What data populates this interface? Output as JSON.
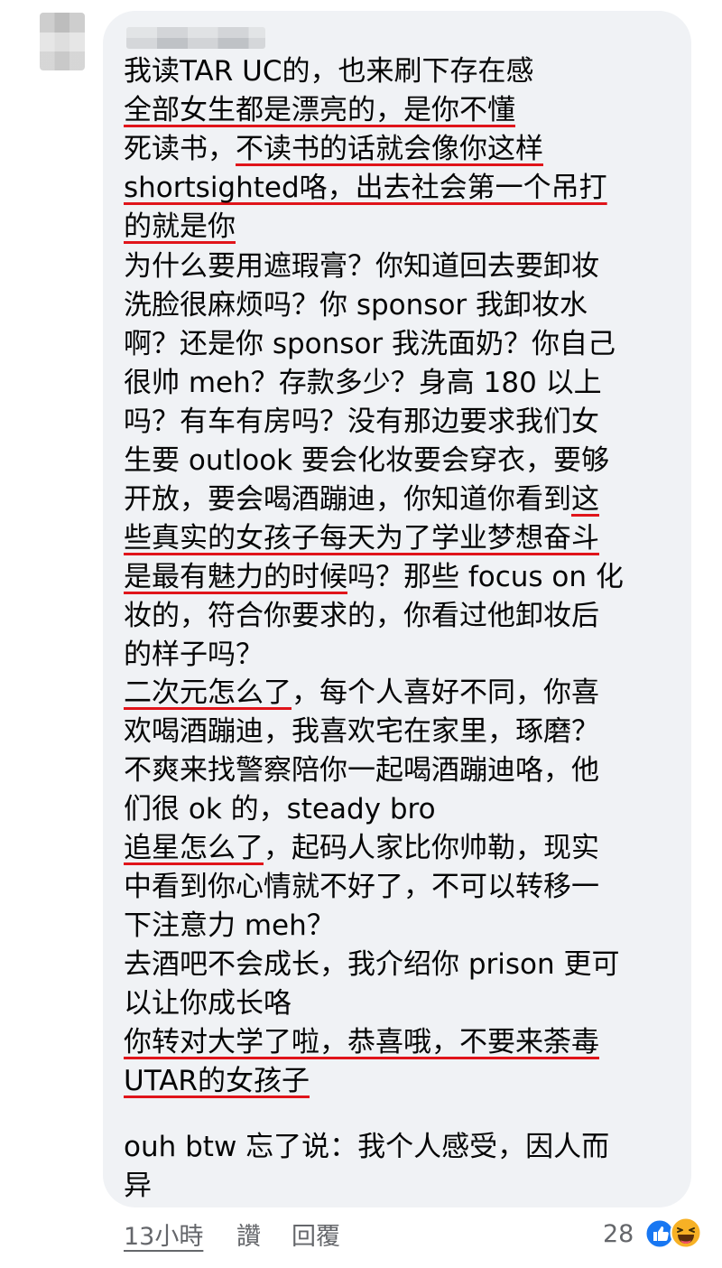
{
  "comment": {
    "lines": [
      {
        "segments": [
          {
            "text": "我读TAR UC的，也来刷下存在感",
            "u": false
          }
        ]
      },
      {
        "segments": [
          {
            "text": "全部女生都是漂亮的，是你不懂",
            "u": true
          }
        ]
      },
      {
        "segments": [
          {
            "text": "死读书，",
            "u": false
          },
          {
            "text": "不读书的话就会像你这样",
            "u": true
          }
        ]
      },
      {
        "segments": [
          {
            "text": "shortsighted咯，出去社会第一个吊打",
            "u": true
          }
        ]
      },
      {
        "segments": [
          {
            "text": "的就是你",
            "u": true
          }
        ]
      },
      {
        "segments": [
          {
            "text": "为什么要用遮瑕膏？你知道回去要卸妆",
            "u": false
          }
        ]
      },
      {
        "segments": [
          {
            "text": "洗脸很麻烦吗？你 sponsor 我卸妆水",
            "u": false
          }
        ]
      },
      {
        "segments": [
          {
            "text": "啊？还是你 sponsor 我洗面奶？你自己",
            "u": false
          }
        ]
      },
      {
        "segments": [
          {
            "text": "很帅 meh？存款多少？身高 180 以上",
            "u": false
          }
        ]
      },
      {
        "segments": [
          {
            "text": "吗？有车有房吗？没有那边要求我们女",
            "u": false
          }
        ]
      },
      {
        "segments": [
          {
            "text": "生要 outlook 要会化妆要会穿衣，要够",
            "u": false
          }
        ]
      },
      {
        "segments": [
          {
            "text": "开放，要会喝酒蹦迪，你知道你看到",
            "u": false
          },
          {
            "text": "这",
            "u": true
          }
        ]
      },
      {
        "segments": [
          {
            "text": "些真实的女孩子每天为了学业梦想奋斗",
            "u": true
          }
        ]
      },
      {
        "segments": [
          {
            "text": "是最有魅力的时候",
            "u": true
          },
          {
            "text": "吗？那些 focus on 化",
            "u": false
          }
        ]
      },
      {
        "segments": [
          {
            "text": "妆的，符合你要求的，你看过他卸妆后",
            "u": false
          }
        ]
      },
      {
        "segments": [
          {
            "text": "的样子吗？",
            "u": false
          }
        ]
      },
      {
        "segments": [
          {
            "text": "二次元怎么了",
            "u": true
          },
          {
            "text": "，每个人喜好不同，你喜",
            "u": false
          }
        ]
      },
      {
        "segments": [
          {
            "text": "欢喝酒蹦迪，我喜欢宅在家里，琢磨？",
            "u": false
          }
        ]
      },
      {
        "segments": [
          {
            "text": "不爽来找警察陪你一起喝酒蹦迪咯，他",
            "u": false
          }
        ]
      },
      {
        "segments": [
          {
            "text": "们很 ok 的，steady bro",
            "u": false
          }
        ]
      },
      {
        "segments": [
          {
            "text": "追星怎么了",
            "u": true
          },
          {
            "text": "，起码人家比你帅勒，现实",
            "u": false
          }
        ]
      },
      {
        "segments": [
          {
            "text": "中看到你心情就不好了，不可以转移一",
            "u": false
          }
        ]
      },
      {
        "segments": [
          {
            "text": "下注意力 meh？",
            "u": false
          }
        ]
      },
      {
        "segments": [
          {
            "text": "去酒吧不会成长，我介绍你 prison 更可",
            "u": false
          }
        ]
      },
      {
        "segments": [
          {
            "text": "以让你成长咯",
            "u": false
          }
        ]
      },
      {
        "segments": [
          {
            "text": "你转对大学了啦，恭喜哦，不要来荼毒",
            "u": true
          }
        ]
      },
      {
        "segments": [
          {
            "text": "UTAR的女孩子",
            "u": true
          }
        ]
      },
      {
        "segments": [
          {
            "text": "ouh btw 忘了说：我个人感受，因人而",
            "u": false
          }
        ]
      },
      {
        "segments": [
          {
            "text": "异",
            "u": false
          }
        ]
      }
    ]
  },
  "actions": {
    "timestamp": "13小時",
    "like_label": "讚",
    "reply_label": "回覆"
  },
  "reactions": {
    "count": "28",
    "icons": [
      "like-icon",
      "haha-icon"
    ],
    "like_color": "#1877f2",
    "haha_color": "#f7b125"
  },
  "colors": {
    "bubble": "#f0f2f5",
    "underline": "#e0141a",
    "text": "#050505",
    "meta": "#65676b"
  }
}
